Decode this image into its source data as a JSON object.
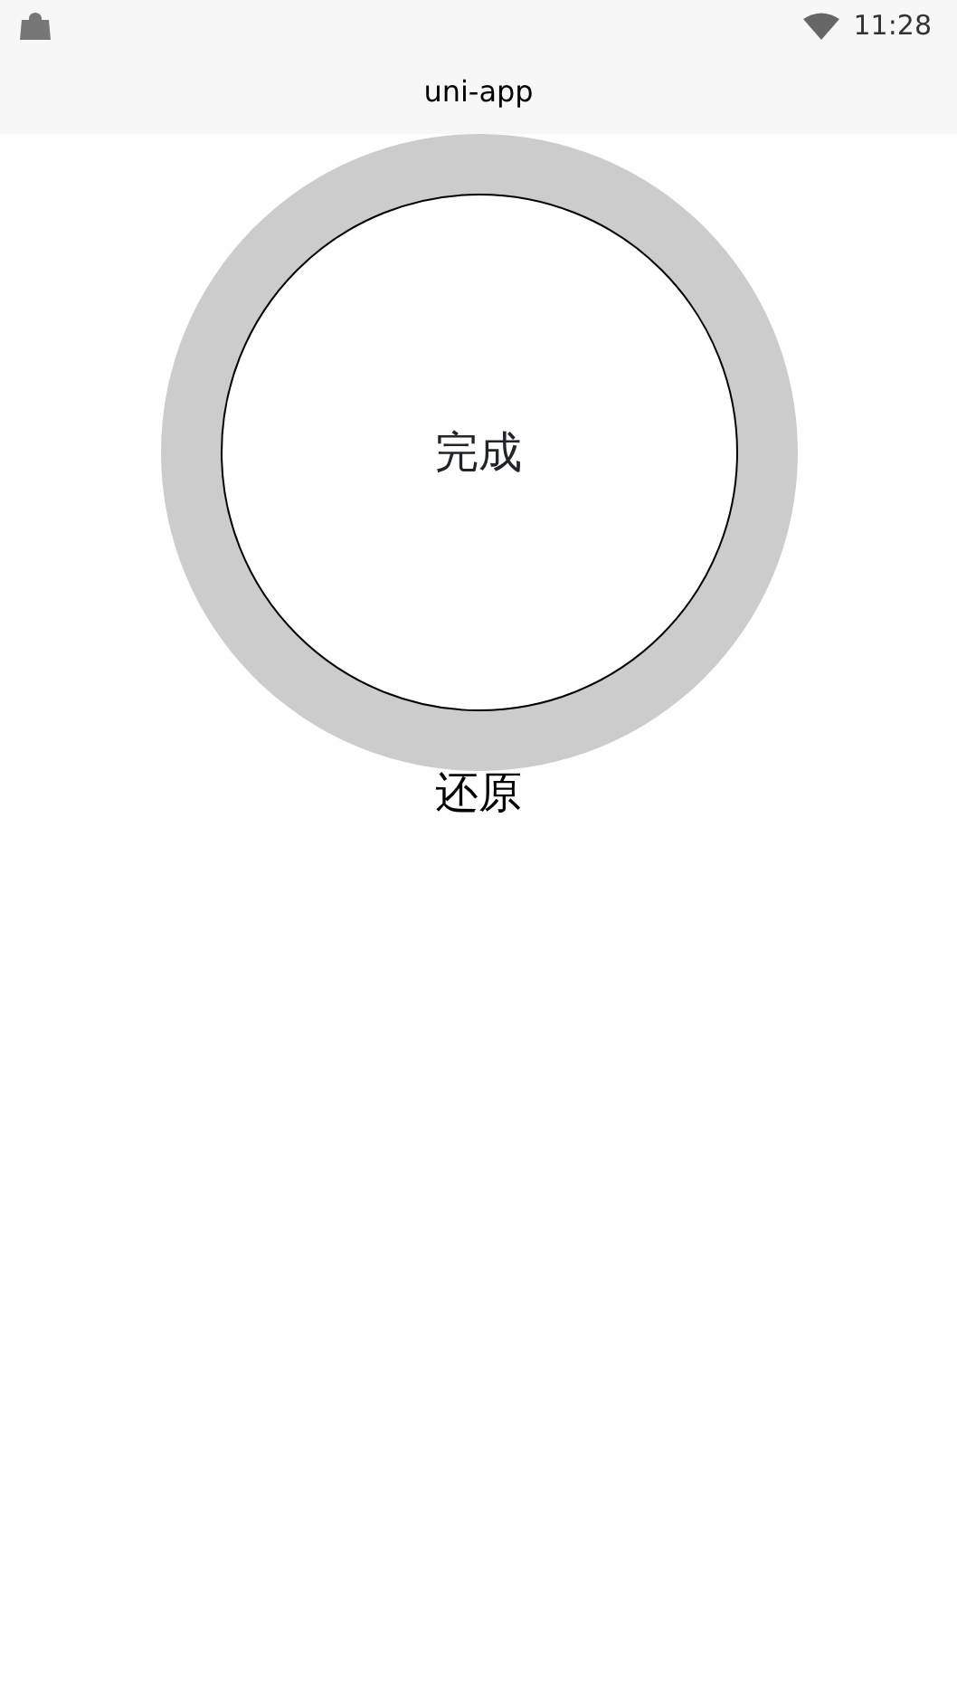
{
  "status_bar": {
    "time": "11:28"
  },
  "nav_bar": {
    "title": "uni-app"
  },
  "dial": {
    "label": "完成"
  },
  "reset": {
    "label": "还原"
  }
}
